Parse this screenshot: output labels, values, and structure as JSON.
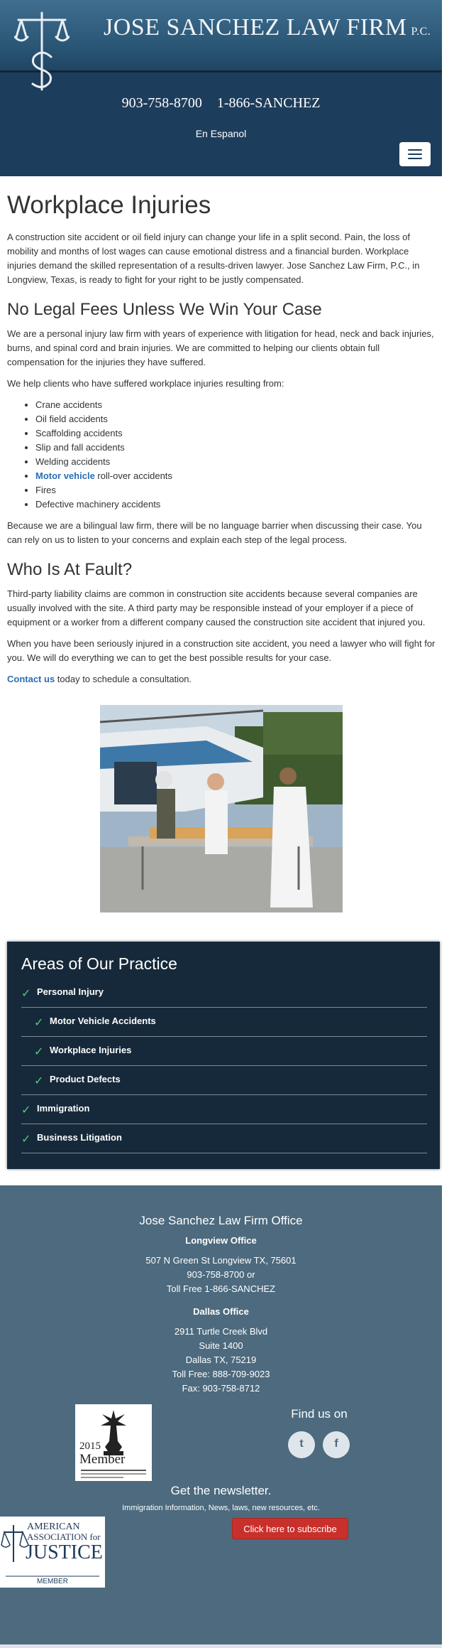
{
  "header": {
    "firm_name": "JOSE SANCHEZ LAW FIRM",
    "firm_suffix": "P.C.",
    "phone_local": "903-758-8700",
    "phone_toll": "1-866-SANCHEZ",
    "language_link": "En Espanol",
    "menu_icon": "hamburger-menu-icon",
    "colors": {
      "header_bg": "#1d3d5c",
      "band_top": "#3f6e8f"
    }
  },
  "article": {
    "title": "Workplace Injuries",
    "intro": "A construction site accident or oil field injury can change your life in a split second. Pain, the loss of mobility and months of lost wages can cause emotional distress and a financial burden. Workplace injuries demand the skilled representation of a results-driven lawyer. Jose Sanchez Law Firm, P.C., in Longview, Texas, is ready to fight for your right to be justly compensated.",
    "section1_title": "No Legal Fees Unless We Win Your Case",
    "section1_p1": "We are a personal injury law firm with years of experience with litigation for head, neck and back injuries, burns, and spinal cord and brain injuries. We are committed to helping our clients obtain full compensation for the injuries they have suffered.",
    "section1_p2": "We help clients who have suffered workplace injuries resulting from:",
    "accidents": [
      "Crane accidents",
      "Oil field accidents",
      "Scaffolding accidents",
      "Slip and fall accidents",
      "Welding accidents",
      "Motor vehicle",
      "roll-over accidents",
      "Fires",
      "Defective machinery accidents"
    ],
    "section1_p3": "Because we are a bilingual law firm, there will be no language barrier when discussing their case. You can rely on us to listen to your concerns and explain each step of the legal process.",
    "section2_title": "Who Is At Fault?",
    "section2_p1": "Third-party liability claims are common in construction site accidents because several companies are usually involved with the site. A third party may be responsible instead of your employer if a piece of equipment or a worker from a different company caused the construction site accident that injured you.",
    "section2_p2": "When you have been seriously injured in a construction site accident, you need a lawyer who will fight for you. We will do everything we can to get the best possible results for your case.",
    "contact_link": "Contact us",
    "contact_rest": " today to schedule a consultation."
  },
  "practice": {
    "title": "Areas of Our Practice",
    "items": [
      {
        "label": "Personal Injury",
        "indent": false
      },
      {
        "label": "Motor Vehicle Accidents",
        "indent": true
      },
      {
        "label": "Workplace Injuries",
        "indent": true
      },
      {
        "label": "Product Defects",
        "indent": true
      },
      {
        "label": "Immigration",
        "indent": false
      },
      {
        "label": "Business Litigation",
        "indent": false
      }
    ],
    "check_icon": "check-icon",
    "colors": {
      "bg": "#16293a",
      "check": "#4ccf7a"
    }
  },
  "footer": {
    "office_title": "Jose Sanchez Law Firm Office",
    "longview_title": "Longview Office",
    "longview_lines": [
      "507 N Green St Longview TX, 75601",
      "903-758-8700 or",
      "Toll Free 1-866-SANCHEZ"
    ],
    "dallas_title": "Dallas Office",
    "dallas_lines": [
      "2911 Turtle Creek Blvd",
      "Suite 1400",
      "Dallas TX, 75219",
      "Toll Free: 888-709-9023",
      "Fax: 903-758-8712"
    ],
    "badge_year": "2015",
    "badge_label": "Member",
    "find_us": "Find us on",
    "social_icons": [
      "twitter-icon",
      "facebook-icon"
    ],
    "newsletter_title": "Get the newsletter.",
    "newsletter_desc": "Immigration Information, News, laws, new resources, etc.",
    "subscribe_label": "Click here to subscribe",
    "aaj_line1": "AMERICAN",
    "aaj_line2": "ASSOCIATION for",
    "aaj_line3": "JUSTICE",
    "aaj_line4": "MEMBER",
    "colors": {
      "footer_bg": "#4d6a7e",
      "subscribe_bg": "#c9302c"
    }
  }
}
